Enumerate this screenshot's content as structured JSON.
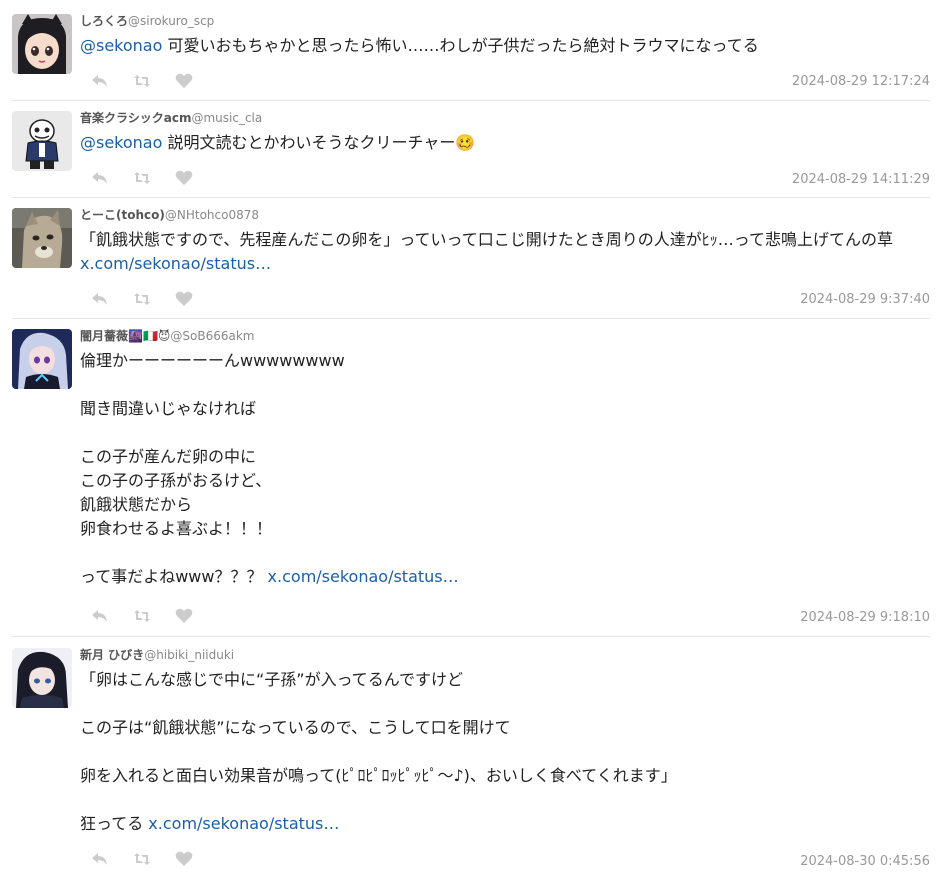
{
  "tweets": [
    {
      "name": "しろくろ",
      "handle": "@sirokuro_scp",
      "mention": "@sekonao",
      "text": " 可愛いおもちゃかと思ったら怖い……わしが子供だったら絶対トラウマになってる",
      "link": "",
      "time": "2024-08-29 12:17:24",
      "avatar": "anime-girl-black-hair"
    },
    {
      "name": "音楽クラシックacm",
      "handle": "@music_cla",
      "mention": "@sekonao",
      "text": " 説明文読むとかわいそうなクリーチャー🥴",
      "link": "",
      "time": "2024-08-29 14:11:29",
      "avatar": "skeleton-character"
    },
    {
      "name": "とーこ(tohco)",
      "handle": "@NHtohco0878",
      "mention": "",
      "text": "「飢餓状態ですので、先程産んだこの卵を」っていって口こじ開けたとき周りの人達がﾋｯ…って悲鳴上げてんの草 ",
      "link": "x.com/sekonao/status…",
      "time": "2024-08-29 9:37:40",
      "avatar": "wolf-mask-photo"
    },
    {
      "name": "闇月薔薇🌆🇮🇹😈",
      "handle": "@SoB666akm",
      "mention": "",
      "text": "倫理かーーーーーーんwwwwwwww\n\n聞き間違いじゃなければ\n\nこの子が産んだ卵の中に\nこの子の子孫がおるけど、\n飢餓状態だから\n卵食わせるよ喜ぶよ！！！\n\nって事だよねwww？？？ ",
      "link": "x.com/sekonao/status…",
      "time": "2024-08-29 9:18:10",
      "avatar": "anime-girl-silver-hair"
    },
    {
      "name": "新月 ひびき",
      "handle": "@hibiki_niiduki",
      "mention": "",
      "text": "「卵はこんな感じで中に“子孫”が入ってるんですけど\n\nこの子は“飢餓状態”になっているので、こうして口を開けて\n\n卵を入れると面白い効果音が鳴って(ﾋﾟﾛﾋﾟﾛｯﾋﾟｯﾋﾟ～♪)、おいしく食べてくれます」\n\n狂ってる ",
      "link": "x.com/sekonao/status…",
      "time": "2024-08-30 0:45:56",
      "avatar": "anime-boy-dark"
    }
  ],
  "icons": {
    "reply": "reply-icon",
    "retweet": "retweet-icon",
    "like": "heart-icon"
  },
  "colors": {
    "link": "#1b5fa8",
    "meta": "#999999",
    "action_icon": "#cccccc",
    "divider": "#e6e6e6"
  }
}
